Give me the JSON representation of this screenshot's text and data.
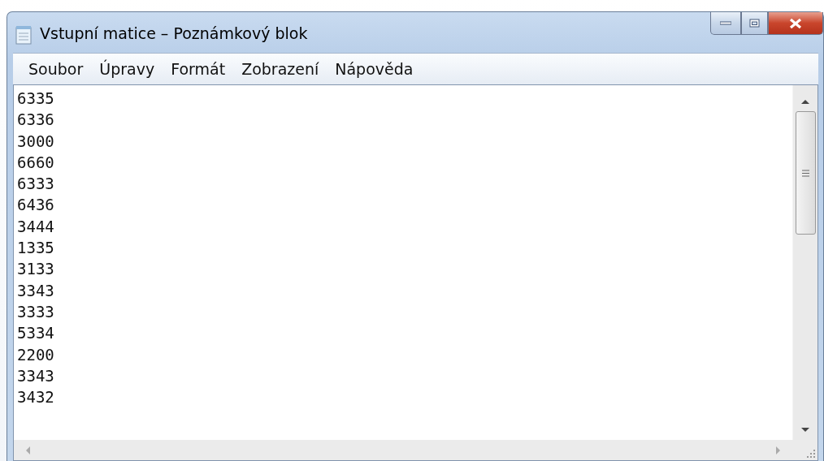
{
  "window": {
    "title": "Vstupní matice – Poznámkový blok"
  },
  "menu": [
    "Soubor",
    "Úpravy",
    "Formát",
    "Zobrazení",
    "Nápověda"
  ],
  "editor": {
    "lines": [
      "6335",
      "6336",
      "3000",
      "6660",
      "6333",
      "6436",
      "3444",
      "1335",
      "3133",
      "3343",
      "3333",
      "5334",
      "2200",
      "3343",
      "3432"
    ]
  }
}
